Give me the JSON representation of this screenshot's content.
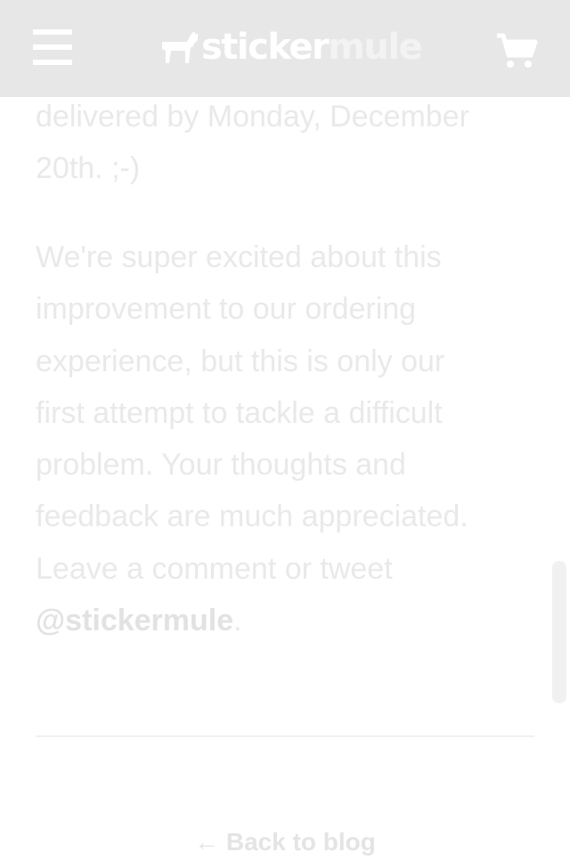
{
  "header": {
    "menu_icon": "hamburger-menu-icon",
    "logo": {
      "part1": "sticker",
      "part2": "mule",
      "mark_icon": "mule-logo-icon"
    },
    "cart_icon": "shopping-cart-icon"
  },
  "article": {
    "paragraph1": [
      "delivered by Monday, December",
      "20th. ;-)"
    ],
    "paragraph2": [
      "We're super excited about this",
      "improvement to our ordering",
      "experience, but this is only our",
      "first attempt to tackle a difficult",
      "problem. Your thoughts and",
      "feedback are much appreciated.",
      "Leave a comment or tweet"
    ],
    "mention": "@stickermule",
    "mention_suffix": "."
  },
  "footer": {
    "back_link": "← Back to blog"
  },
  "colors": {
    "header_bg": "#e7e7e7",
    "text": "#e9e9e9",
    "divider": "#f1f1f1"
  }
}
